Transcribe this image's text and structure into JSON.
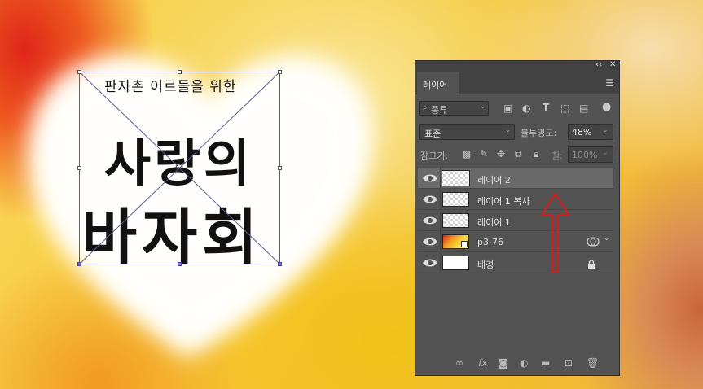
{
  "canvas": {
    "art": {
      "small_line": "판자촌 어르들을 위한",
      "big_line_1": "사랑의",
      "big_line_2": "바자회"
    }
  },
  "panel": {
    "collapse_glyph": "‹‹",
    "close_glyph": "✕",
    "tab_label": "레이어",
    "menu_icon": "hamburger-icon",
    "filter": {
      "label": "종류",
      "icons": [
        "image-filter-icon",
        "adjustment-filter-icon",
        "type-filter-icon",
        "shape-filter-icon",
        "smart-object-filter-icon",
        "toggle-filter-icon"
      ]
    },
    "blend": {
      "mode": "표준",
      "opacity_label": "불투명도:",
      "opacity_value": "48%"
    },
    "lock": {
      "label": "잠그기:",
      "fill_label": "칠:",
      "fill_value": "100%"
    },
    "layers": [
      {
        "name": "레이어 2",
        "selected": true,
        "thumb": "transparent"
      },
      {
        "name": "레이어 1 복사",
        "selected": false,
        "thumb": "transparent"
      },
      {
        "name": "레이어 1",
        "selected": false,
        "thumb": "transparent"
      },
      {
        "name": "p3-76",
        "selected": false,
        "thumb": "photo"
      },
      {
        "name": "배경",
        "selected": false,
        "thumb": "white"
      }
    ],
    "bottom_icons": [
      "link-icon",
      "fx-icon",
      "mask-icon",
      "adjustment-icon",
      "folder-icon",
      "new-layer-icon",
      "trash-icon"
    ],
    "colors": {
      "panel_bg": "#535353",
      "selected_row": "#6a6a6a",
      "arrow": "#d11f1f"
    }
  }
}
